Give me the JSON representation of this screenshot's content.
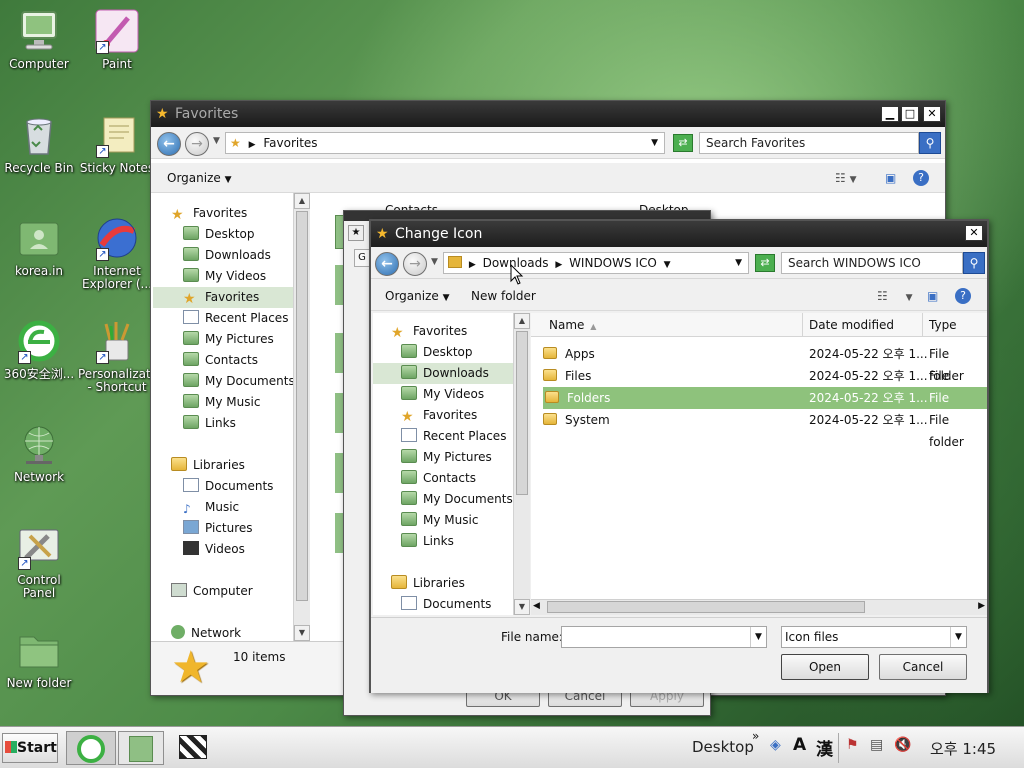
{
  "desktop": {
    "icons": [
      {
        "label": "Computer",
        "icon": "computer-icon"
      },
      {
        "label": "Paint",
        "icon": "paint-icon"
      },
      {
        "label": "Recycle Bin",
        "icon": "recycle-bin-icon"
      },
      {
        "label": "Sticky Notes",
        "icon": "sticky-notes-icon"
      },
      {
        "label": "korea.in",
        "icon": "user-folder-icon"
      },
      {
        "label": "Internet Explorer (...",
        "icon": "internet-explorer-icon"
      },
      {
        "label": "360安全浏...",
        "icon": "360-browser-icon"
      },
      {
        "label": "Personalizat... - Shortcut",
        "icon": "personalization-icon"
      },
      {
        "label": "Network",
        "icon": "network-icon"
      },
      {
        "label": "Control Panel",
        "icon": "control-panel-icon"
      },
      {
        "label": "New folder",
        "icon": "folder-icon"
      }
    ]
  },
  "favorites_window": {
    "title": "Favorites",
    "address": "Favorites",
    "search_placeholder": "Search Favorites",
    "organize": "Organize",
    "nav": [
      "Favorites",
      "Desktop",
      "Downloads",
      "My Videos",
      "Favorites",
      "Recent Places",
      "My Pictures",
      "Contacts",
      "My Documents",
      "My Music",
      "Links",
      "Libraries",
      "Documents",
      "Music",
      "Pictures",
      "Videos",
      "Computer",
      "Network"
    ],
    "content_partial": {
      "name_col": "Contacts",
      "location_col": "Desktop"
    },
    "status": "10 items",
    "back_buttons": [
      "OK",
      "Cancel",
      "Apply"
    ]
  },
  "change_icon_dialog": {
    "title": "Change Icon",
    "breadcrumb": [
      "Downloads",
      "WINDOWS ICO"
    ],
    "search_placeholder": "Search WINDOWS ICO",
    "organize": "Organize",
    "new_folder": "New folder",
    "nav": [
      "Favorites",
      "Desktop",
      "Downloads",
      "My Videos",
      "Favorites",
      "Recent Places",
      "My Pictures",
      "Contacts",
      "My Documents",
      "My Music",
      "Links",
      "Libraries",
      "Documents"
    ],
    "columns": {
      "name": "Name",
      "date": "Date modified",
      "type": "Type"
    },
    "files": [
      {
        "name": "Apps",
        "date": "2024-05-22 오후 1...",
        "type": "File folder"
      },
      {
        "name": "Files",
        "date": "2024-05-22 오후 1...",
        "type": "File folder"
      },
      {
        "name": "Folders",
        "date": "2024-05-22 오후 1...",
        "type": "File folder"
      },
      {
        "name": "System",
        "date": "2024-05-22 오후 1...",
        "type": "File folder"
      }
    ],
    "file_name_label": "File name:",
    "file_name_value": "",
    "file_type": "Icon files",
    "open": "Open",
    "cancel": "Cancel"
  },
  "taskbar": {
    "start": "Start",
    "desktop_label": "Desktop",
    "ime_a": "A",
    "ime_han": "漢",
    "clock": "오후 1:45"
  }
}
